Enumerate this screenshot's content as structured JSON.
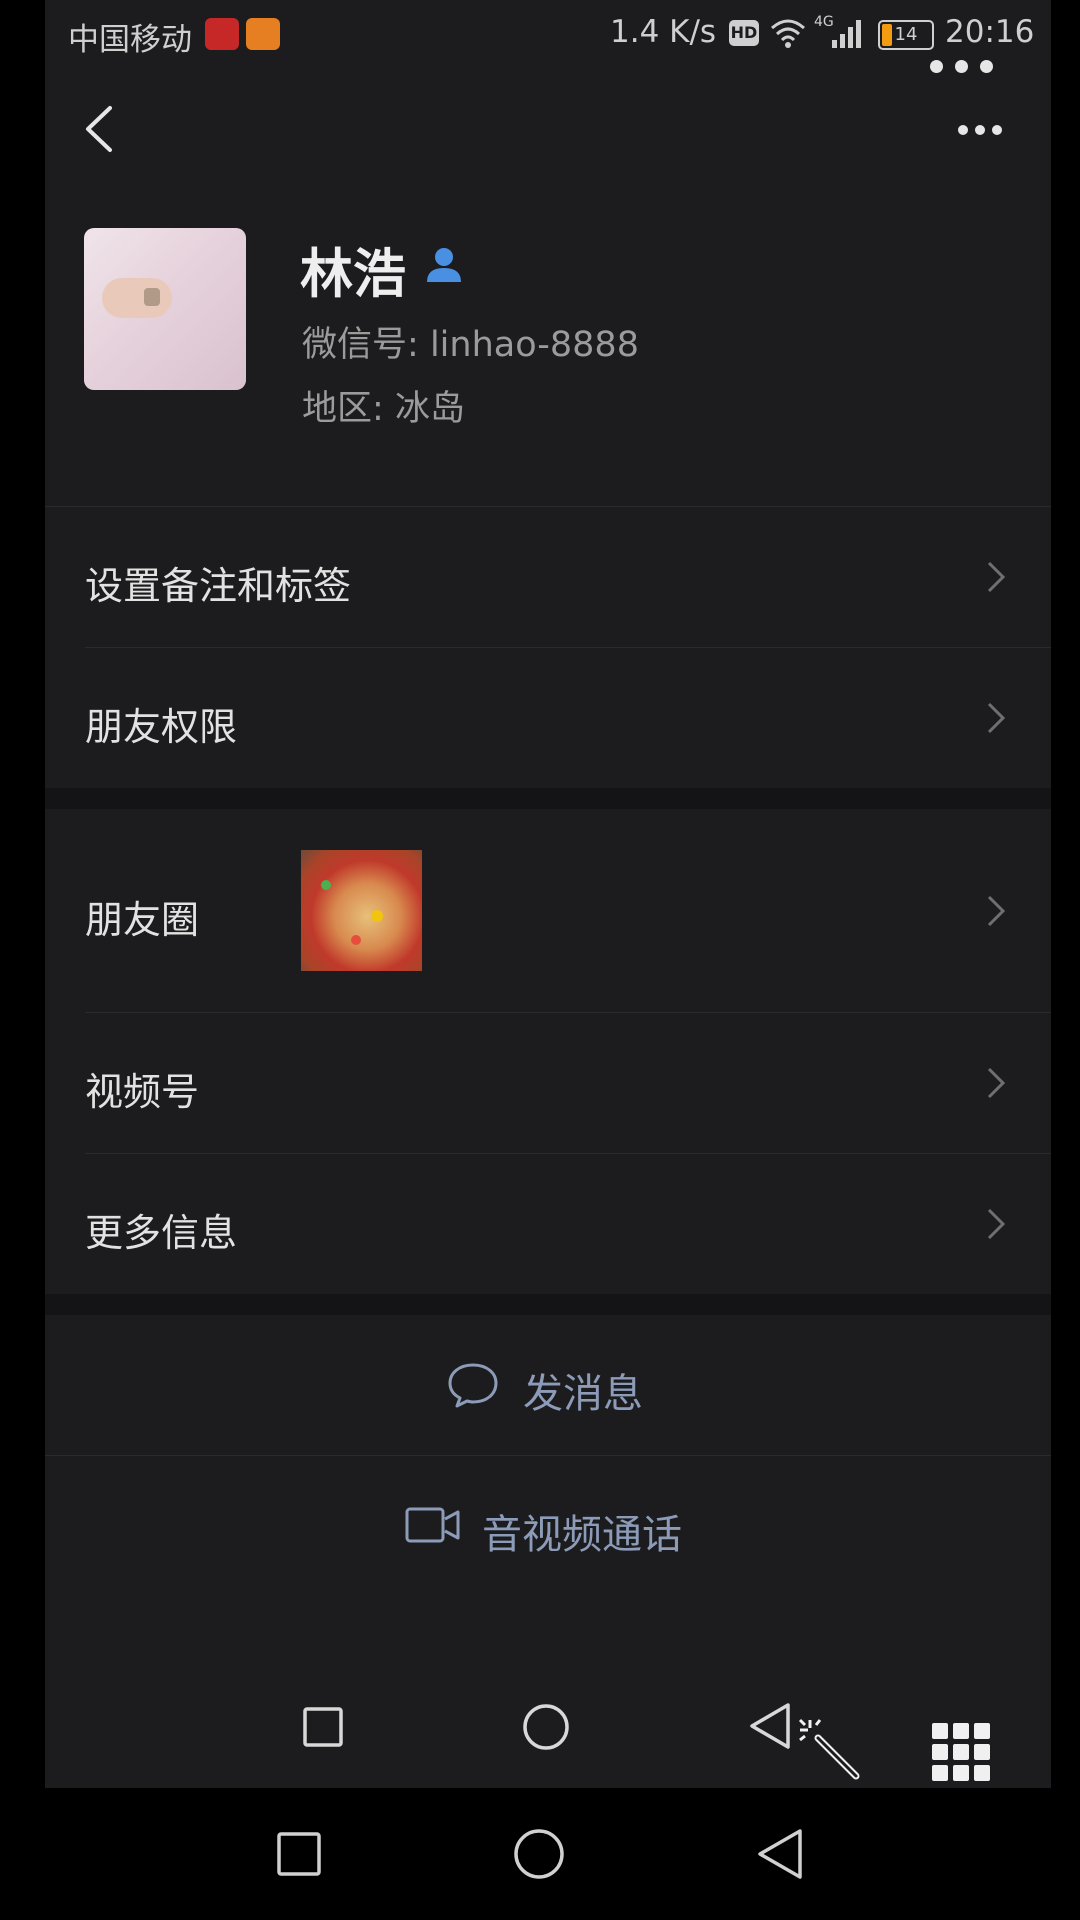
{
  "status_bar": {
    "carrier": "中国移动",
    "speed": "1.4 K/s",
    "hd_badge": "HD",
    "network": "4G",
    "battery": "14",
    "time": "20:16"
  },
  "header": {
    "back_icon": "chevron-left-icon",
    "more_icon": "more-dots-icon"
  },
  "profile": {
    "name": "林浩",
    "wechat_id_label": "微信号:",
    "wechat_id": "linhao-8888",
    "region_label": "地区:",
    "region": "冰岛"
  },
  "menu": {
    "remark_tags": "设置备注和标签",
    "friend_permissions": "朋友权限",
    "moments": "朋友圈",
    "channels": "视频号",
    "more_info": "更多信息"
  },
  "actions": {
    "send_message": "发消息",
    "video_call": "音视频通话"
  },
  "colors": {
    "accent": "#8c9bb8",
    "background": "#1c1c1e",
    "contact_icon": "#4a90e2"
  }
}
